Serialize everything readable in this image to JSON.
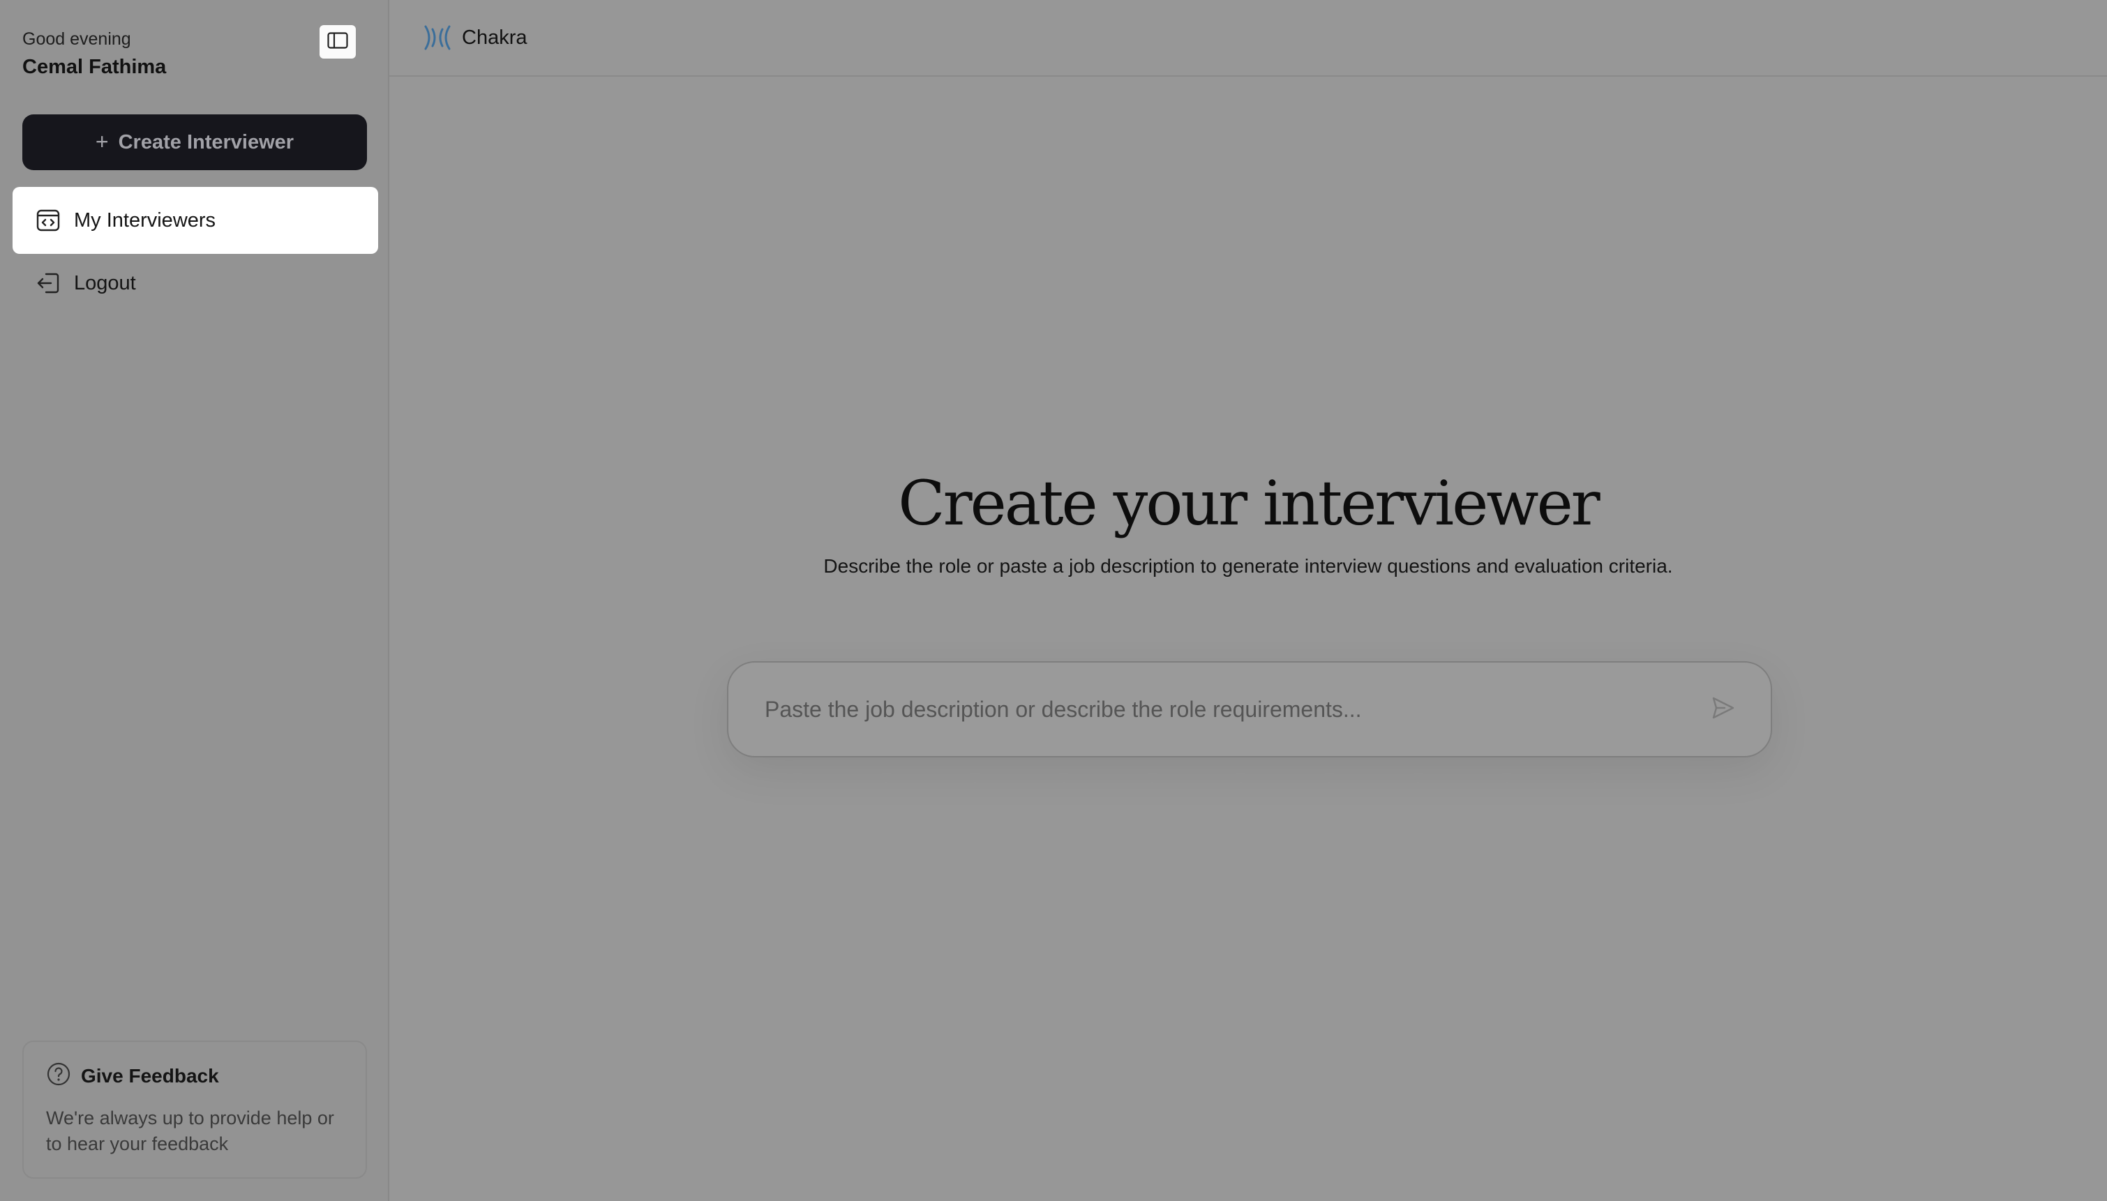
{
  "sidebar": {
    "greeting": "Good evening",
    "user_name": "Cemal Fathima",
    "create_button_label": "Create Interviewer",
    "items": [
      {
        "label": "My Interviewers",
        "icon": "code-window-icon",
        "active": true
      },
      {
        "label": "Logout",
        "icon": "logout-icon",
        "active": false
      }
    ],
    "feedback": {
      "title": "Give Feedback",
      "text": "We're always up to provide help or to hear your feedback",
      "icon": "help-circle-icon"
    }
  },
  "header": {
    "brand_name": "Chakra",
    "brand_icon": "chakra-logo-icon"
  },
  "main": {
    "title": "Create your interviewer",
    "subtitle": "Describe the role or paste a job description to generate interview questions and evaluation criteria.",
    "input_placeholder": "Paste the job description or describe the role requirements...",
    "input_value": ""
  },
  "colors": {
    "overlay_bg": "#979797",
    "primary_button": "#16161c",
    "brand_accent": "#3b6e9a"
  }
}
